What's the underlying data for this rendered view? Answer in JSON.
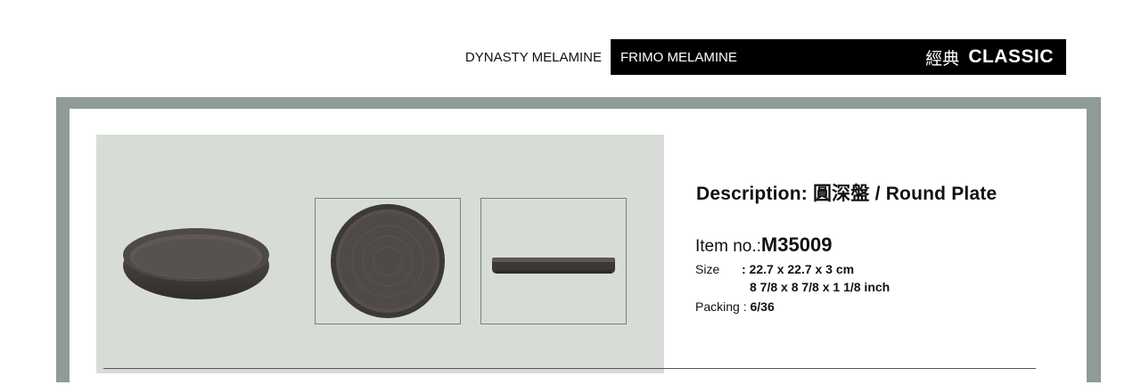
{
  "header": {
    "brand_left": "DYNASTY MELAMINE",
    "brand_active": "FRIMO MELAMINE",
    "series_cn": "經典",
    "series_en": "CLASSIC"
  },
  "product": {
    "description_label": "Description:",
    "description_cn": "圓深盤",
    "description_en": "/ Round  Plate",
    "item_label": "Item no.:",
    "item_no": "M35009",
    "size_label": "Size",
    "size_metric": ": 22.7 x 22.7 x 3 cm",
    "size_imperial": "8 7/8 x 8 7/8 x 1 1/8 inch",
    "packing_label": "Packing :",
    "packing_value": "6/36"
  },
  "images": [
    {
      "name": "plate-angle-view",
      "icon": "round-plate-angle"
    },
    {
      "name": "plate-top-view",
      "icon": "round-plate-top"
    },
    {
      "name": "plate-side-view",
      "icon": "round-plate-side"
    }
  ],
  "colors": {
    "header_bar": "#000000",
    "frame": "#8e9b99",
    "photo_panel": "#d7ddd6",
    "plate": "#4a4643"
  }
}
